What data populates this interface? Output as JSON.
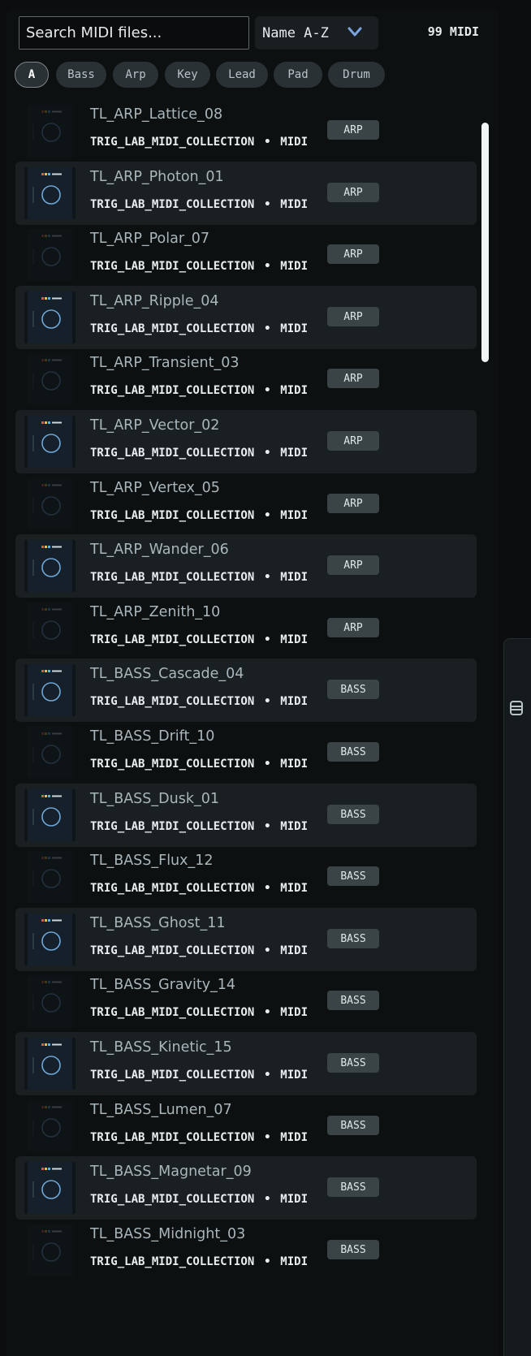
{
  "search": {
    "placeholder": "Search MIDI files..."
  },
  "sort": {
    "selected": "Name A-Z",
    "icon": "chevron-down-icon",
    "icon_color": "#7aa3e0"
  },
  "count_label": "99 MIDI",
  "filters": [
    {
      "label": "A",
      "active": true
    },
    {
      "label": "Bass",
      "active": false
    },
    {
      "label": "Arp",
      "active": false
    },
    {
      "label": "Key",
      "active": false
    },
    {
      "label": "Lead",
      "active": false
    },
    {
      "label": "Pad",
      "active": false
    },
    {
      "label": "Drum",
      "active": false
    }
  ],
  "items": [
    {
      "name": "TL_ARP_Lattice_08",
      "collection": "TRIG_LAB_MIDI_COLLECTION",
      "format": "MIDI",
      "tag": "ARP",
      "highlighted": false
    },
    {
      "name": "TL_ARP_Photon_01",
      "collection": "TRIG_LAB_MIDI_COLLECTION",
      "format": "MIDI",
      "tag": "ARP",
      "highlighted": true
    },
    {
      "name": "TL_ARP_Polar_07",
      "collection": "TRIG_LAB_MIDI_COLLECTION",
      "format": "MIDI",
      "tag": "ARP",
      "highlighted": false
    },
    {
      "name": "TL_ARP_Ripple_04",
      "collection": "TRIG_LAB_MIDI_COLLECTION",
      "format": "MIDI",
      "tag": "ARP",
      "highlighted": true
    },
    {
      "name": "TL_ARP_Transient_03",
      "collection": "TRIG_LAB_MIDI_COLLECTION",
      "format": "MIDI",
      "tag": "ARP",
      "highlighted": false
    },
    {
      "name": "TL_ARP_Vector_02",
      "collection": "TRIG_LAB_MIDI_COLLECTION",
      "format": "MIDI",
      "tag": "ARP",
      "highlighted": true
    },
    {
      "name": "TL_ARP_Vertex_05",
      "collection": "TRIG_LAB_MIDI_COLLECTION",
      "format": "MIDI",
      "tag": "ARP",
      "highlighted": false
    },
    {
      "name": "TL_ARP_Wander_06",
      "collection": "TRIG_LAB_MIDI_COLLECTION",
      "format": "MIDI",
      "tag": "ARP",
      "highlighted": true
    },
    {
      "name": "TL_ARP_Zenith_10",
      "collection": "TRIG_LAB_MIDI_COLLECTION",
      "format": "MIDI",
      "tag": "ARP",
      "highlighted": false
    },
    {
      "name": "TL_BASS_Cascade_04",
      "collection": "TRIG_LAB_MIDI_COLLECTION",
      "format": "MIDI",
      "tag": "BASS",
      "highlighted": true
    },
    {
      "name": "TL_BASS_Drift_10",
      "collection": "TRIG_LAB_MIDI_COLLECTION",
      "format": "MIDI",
      "tag": "BASS",
      "highlighted": false
    },
    {
      "name": "TL_BASS_Dusk_01",
      "collection": "TRIG_LAB_MIDI_COLLECTION",
      "format": "MIDI",
      "tag": "BASS",
      "highlighted": true
    },
    {
      "name": "TL_BASS_Flux_12",
      "collection": "TRIG_LAB_MIDI_COLLECTION",
      "format": "MIDI",
      "tag": "BASS",
      "highlighted": false
    },
    {
      "name": "TL_BASS_Ghost_11",
      "collection": "TRIG_LAB_MIDI_COLLECTION",
      "format": "MIDI",
      "tag": "BASS",
      "highlighted": true
    },
    {
      "name": "TL_BASS_Gravity_14",
      "collection": "TRIG_LAB_MIDI_COLLECTION",
      "format": "MIDI",
      "tag": "BASS",
      "highlighted": false
    },
    {
      "name": "TL_BASS_Kinetic_15",
      "collection": "TRIG_LAB_MIDI_COLLECTION",
      "format": "MIDI",
      "tag": "BASS",
      "highlighted": true
    },
    {
      "name": "TL_BASS_Lumen_07",
      "collection": "TRIG_LAB_MIDI_COLLECTION",
      "format": "MIDI",
      "tag": "BASS",
      "highlighted": false
    },
    {
      "name": "TL_BASS_Magnetar_09",
      "collection": "TRIG_LAB_MIDI_COLLECTION",
      "format": "MIDI",
      "tag": "BASS",
      "highlighted": true
    },
    {
      "name": "TL_BASS_Midnight_03",
      "collection": "TRIG_LAB_MIDI_COLLECTION",
      "format": "MIDI",
      "tag": "BASS",
      "highlighted": false
    }
  ],
  "separator": "•",
  "side_panel": {
    "icon": "panel-toggle-icon"
  }
}
